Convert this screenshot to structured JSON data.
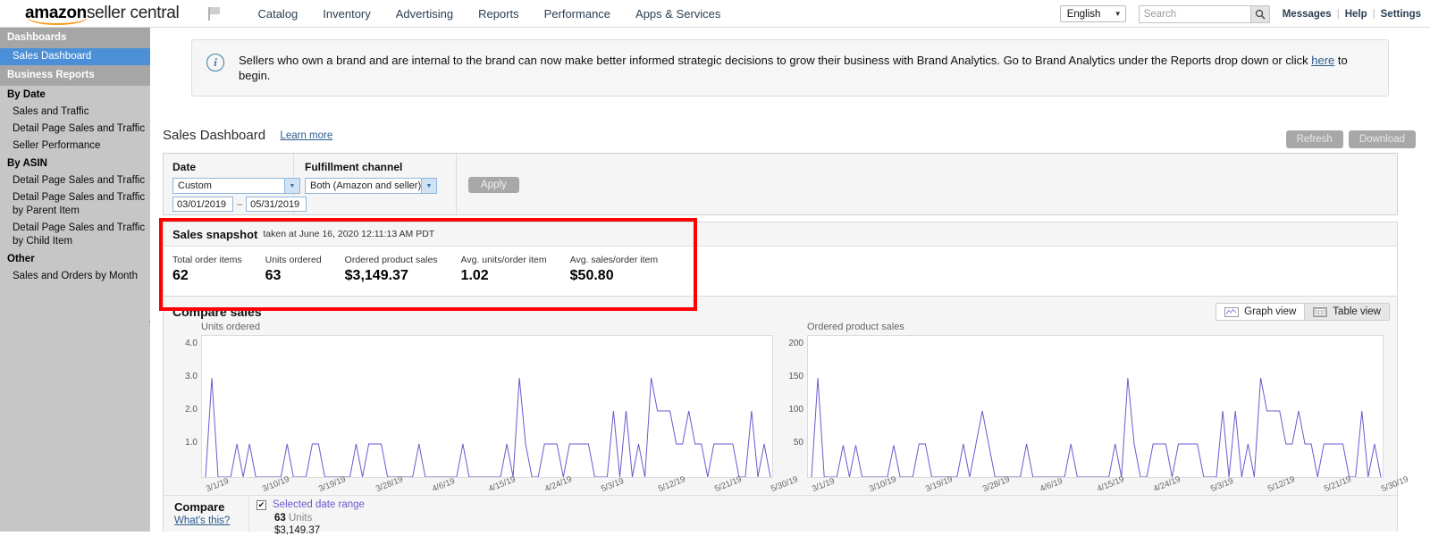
{
  "brand": {
    "amazon": "amazon",
    "seller_central": "seller central"
  },
  "topnav": {
    "items": [
      "Catalog",
      "Inventory",
      "Advertising",
      "Reports",
      "Performance",
      "Apps & Services"
    ],
    "language": "English",
    "search_placeholder": "Search",
    "links": [
      "Messages",
      "Help",
      "Settings"
    ]
  },
  "sidebar": {
    "groups": [
      {
        "header": "Dashboards",
        "items": [
          {
            "label": "Sales Dashboard",
            "selected": true
          }
        ]
      },
      {
        "header": "Business Reports",
        "sections": [
          {
            "title": "By Date",
            "items": [
              "Sales and Traffic",
              "Detail Page Sales and Traffic",
              "Seller Performance"
            ]
          },
          {
            "title": "By ASIN",
            "items": [
              "Detail Page Sales and Traffic",
              "Detail Page Sales and Traffic by Parent Item",
              "Detail Page Sales and Traffic by Child Item"
            ]
          },
          {
            "title": "Other",
            "items": [
              "Sales and Orders by Month"
            ]
          }
        ]
      }
    ],
    "reports_tab": "Reports"
  },
  "notice": {
    "text": "Sellers who own a brand and are internal to the brand can now make better informed strategic decisions to grow their business with Brand Analytics. Go to Brand Analytics under the Reports drop down or click ",
    "link": "here",
    "text_after": " to begin."
  },
  "page": {
    "title": "Sales Dashboard",
    "learn_more": "Learn more",
    "refresh": "Refresh",
    "download": "Download"
  },
  "filters": {
    "date_label": "Date",
    "date_preset": "Custom",
    "date_from": "03/01/2019",
    "date_to": "05/31/2019",
    "date_dash": "–",
    "channel_label": "Fulfillment channel",
    "channel_value": "Both (Amazon and seller)",
    "apply": "Apply"
  },
  "snapshot": {
    "title": "Sales snapshot",
    "taken_at": "taken at June 16, 2020 12:11:13 AM PDT",
    "metrics": [
      {
        "label": "Total order items",
        "value": "62"
      },
      {
        "label": "Units ordered",
        "value": "63"
      },
      {
        "label": "Ordered product sales",
        "value": "$3,149.37"
      },
      {
        "label": "Avg. units/order item",
        "value": "1.02"
      },
      {
        "label": "Avg. sales/order item",
        "value": "$50.80"
      }
    ]
  },
  "compare": {
    "title": "Compare sales",
    "graph_view": "Graph view",
    "table_view": "Table view",
    "footer_label": "Compare",
    "whats_this": "What's this?",
    "legend_range": "Selected date range",
    "legend_units_value": "63",
    "legend_units_word": "Units",
    "legend_money": "$3,149.37",
    "line_color": "#6a5acd"
  },
  "chart_data": [
    {
      "type": "line",
      "title": "Units ordered",
      "ylabel": "Units ordered",
      "xlabel": "",
      "ylim": [
        0,
        4
      ],
      "yticks": [
        "4.0",
        "3.0",
        "2.0",
        "1.0"
      ],
      "grid": false,
      "legend": "Selected date range",
      "xticks": [
        "3/1/19",
        "3/10/19",
        "3/19/19",
        "3/28/19",
        "4/6/19",
        "4/15/19",
        "4/24/19",
        "5/3/19",
        "5/12/19",
        "5/21/19",
        "5/30/19"
      ],
      "x": [
        "3/1/19",
        "3/2/19",
        "3/3/19",
        "3/4/19",
        "3/5/19",
        "3/6/19",
        "3/7/19",
        "3/8/19",
        "3/9/19",
        "3/10/19",
        "3/11/19",
        "3/12/19",
        "3/13/19",
        "3/14/19",
        "3/15/19",
        "3/16/19",
        "3/17/19",
        "3/18/19",
        "3/19/19",
        "3/20/19",
        "3/21/19",
        "3/22/19",
        "3/23/19",
        "3/24/19",
        "3/25/19",
        "3/26/19",
        "3/27/19",
        "3/28/19",
        "3/29/19",
        "3/30/19",
        "3/31/19",
        "4/1/19",
        "4/2/19",
        "4/3/19",
        "4/4/19",
        "4/5/19",
        "4/6/19",
        "4/7/19",
        "4/8/19",
        "4/9/19",
        "4/10/19",
        "4/11/19",
        "4/12/19",
        "4/13/19",
        "4/14/19",
        "4/15/19",
        "4/16/19",
        "4/17/19",
        "4/18/19",
        "4/19/19",
        "4/20/19",
        "4/21/19",
        "4/22/19",
        "4/23/19",
        "4/24/19",
        "4/25/19",
        "4/26/19",
        "4/27/19",
        "4/28/19",
        "4/29/19",
        "4/30/19",
        "5/1/19",
        "5/2/19",
        "5/3/19",
        "5/4/19",
        "5/5/19",
        "5/6/19",
        "5/7/19",
        "5/8/19",
        "5/9/19",
        "5/10/19",
        "5/11/19",
        "5/12/19",
        "5/13/19",
        "5/14/19",
        "5/15/19",
        "5/16/19",
        "5/17/19",
        "5/18/19",
        "5/19/19",
        "5/20/19",
        "5/21/19",
        "5/22/19",
        "5/23/19",
        "5/24/19",
        "5/25/19",
        "5/26/19",
        "5/27/19",
        "5/28/19",
        "5/29/19",
        "5/30/19",
        "5/31/19"
      ],
      "values": [
        0,
        3,
        0,
        0,
        0,
        1,
        0,
        1,
        0,
        0,
        0,
        0,
        0,
        1,
        0,
        0,
        0,
        1,
        1,
        0,
        0,
        0,
        0,
        0,
        1,
        0,
        1,
        1,
        1,
        0,
        0,
        0,
        0,
        0,
        1,
        0,
        0,
        0,
        0,
        0,
        0,
        1,
        0,
        0,
        0,
        0,
        0,
        0,
        1,
        0,
        3,
        1,
        0,
        0,
        1,
        1,
        1,
        0,
        1,
        1,
        1,
        1,
        0,
        0,
        0,
        2,
        0,
        2,
        0,
        1,
        0,
        3,
        2,
        2,
        2,
        1,
        1,
        2,
        1,
        1,
        0,
        1,
        1,
        1,
        1,
        0,
        0,
        2,
        0,
        1,
        0
      ]
    },
    {
      "type": "line",
      "title": "Ordered product sales",
      "ylabel": "Ordered product sales",
      "xlabel": "",
      "ylim": [
        0,
        200
      ],
      "yticks": [
        "200",
        "150",
        "100",
        "50"
      ],
      "grid": false,
      "legend": "Selected date range",
      "xticks": [
        "3/1/19",
        "3/10/19",
        "3/19/19",
        "3/28/19",
        "4/6/19",
        "4/15/19",
        "4/24/19",
        "5/3/19",
        "5/12/19",
        "5/21/19",
        "5/30/19"
      ],
      "x": [
        "3/1/19",
        "3/2/19",
        "3/3/19",
        "3/4/19",
        "3/5/19",
        "3/6/19",
        "3/7/19",
        "3/8/19",
        "3/9/19",
        "3/10/19",
        "3/11/19",
        "3/12/19",
        "3/13/19",
        "3/14/19",
        "3/15/19",
        "3/16/19",
        "3/17/19",
        "3/18/19",
        "3/19/19",
        "3/20/19",
        "3/21/19",
        "3/22/19",
        "3/23/19",
        "3/24/19",
        "3/25/19",
        "3/26/19",
        "3/27/19",
        "3/28/19",
        "3/29/19",
        "3/30/19",
        "3/31/19",
        "4/1/19",
        "4/2/19",
        "4/3/19",
        "4/4/19",
        "4/5/19",
        "4/6/19",
        "4/7/19",
        "4/8/19",
        "4/9/19",
        "4/10/19",
        "4/11/19",
        "4/12/19",
        "4/13/19",
        "4/14/19",
        "4/15/19",
        "4/16/19",
        "4/17/19",
        "4/18/19",
        "4/19/19",
        "4/20/19",
        "4/21/19",
        "4/22/19",
        "4/23/19",
        "4/24/19",
        "4/25/19",
        "4/26/19",
        "4/27/19",
        "4/28/19",
        "4/29/19",
        "4/30/19",
        "5/1/19",
        "5/2/19",
        "5/3/19",
        "5/4/19",
        "5/5/19",
        "5/6/19",
        "5/7/19",
        "5/8/19",
        "5/9/19",
        "5/10/19",
        "5/11/19",
        "5/12/19",
        "5/13/19",
        "5/14/19",
        "5/15/19",
        "5/16/19",
        "5/17/19",
        "5/18/19",
        "5/19/19",
        "5/20/19",
        "5/21/19",
        "5/22/19",
        "5/23/19",
        "5/24/19",
        "5/25/19",
        "5/26/19",
        "5/27/19",
        "5/28/19",
        "5/29/19",
        "5/30/19",
        "5/31/19"
      ],
      "values": [
        0,
        150,
        0,
        0,
        0,
        48,
        0,
        48,
        0,
        0,
        0,
        0,
        0,
        48,
        0,
        0,
        0,
        50,
        50,
        0,
        0,
        0,
        0,
        0,
        50,
        0,
        50,
        100,
        50,
        0,
        0,
        0,
        0,
        0,
        50,
        0,
        0,
        0,
        0,
        0,
        0,
        50,
        0,
        0,
        0,
        0,
        0,
        0,
        50,
        0,
        150,
        50,
        0,
        0,
        50,
        50,
        50,
        0,
        50,
        50,
        50,
        50,
        0,
        0,
        0,
        100,
        0,
        100,
        0,
        50,
        0,
        150,
        100,
        100,
        100,
        50,
        50,
        100,
        50,
        50,
        0,
        50,
        50,
        50,
        50,
        0,
        0,
        100,
        0,
        50,
        0
      ]
    }
  ]
}
